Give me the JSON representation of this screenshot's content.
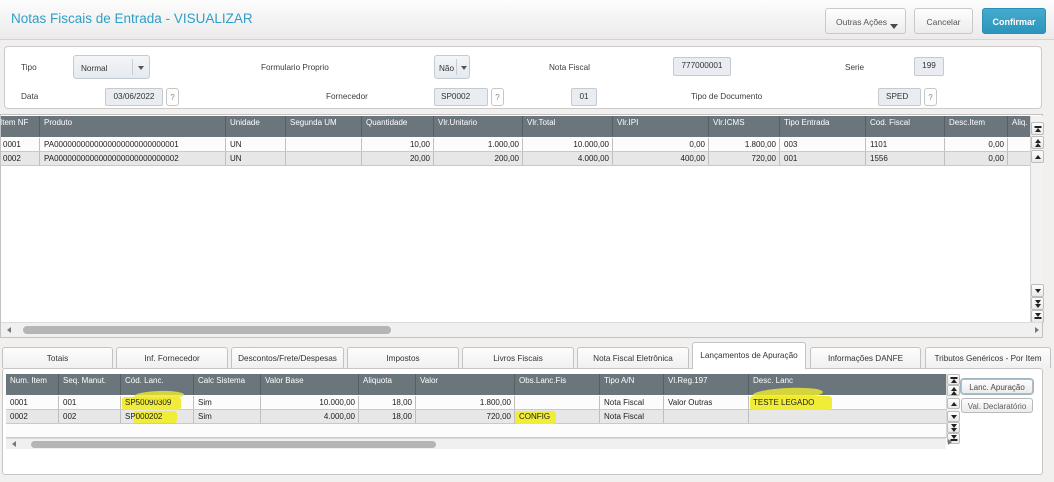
{
  "window": {
    "title": "Notas Fiscais de Entrada - VISUALIZAR"
  },
  "toolbar": {
    "outras_acoes": "Outras Ações",
    "cancelar": "Cancelar",
    "confirmar": "Confirmar"
  },
  "form": {
    "tipo": {
      "label": "Tipo",
      "value": "Normal"
    },
    "formulario_proprio": {
      "label": "Formulario Proprio",
      "value": "Não"
    },
    "nota_fiscal": {
      "label": "Nota Fiscal",
      "value": "777000001"
    },
    "serie": {
      "label": "Serie",
      "value": "199"
    },
    "data": {
      "label": "Data",
      "value": "03/06/2022",
      "helper": "?"
    },
    "fornecedor": {
      "label": "Fornecedor",
      "value": "SP0002",
      "helper": "?",
      "loja": "01"
    },
    "tipo_documento": {
      "label": "Tipo de Documento",
      "value": "SPED",
      "helper": "?"
    }
  },
  "items_grid": {
    "columns": [
      "Item NF",
      "Produto",
      "Unidade",
      "Segunda UM",
      "Quantidade",
      "Vlr.Unitario",
      "Vlr.Total",
      "Vlr.IPI",
      "Vlr.ICMS",
      "Tipo Entrada",
      "Cod. Fiscal",
      "Desc.Item",
      "Aliq. I"
    ],
    "rows": [
      [
        "0001",
        "PA0000000000000000000000000001",
        "UN",
        "",
        "10,00",
        "1.000,00",
        "10.000,00",
        "0,00",
        "1.800,00",
        "003",
        "1101",
        "0,00",
        ""
      ],
      [
        "0002",
        "PA0000000000000000000000000002",
        "UN",
        "",
        "20,00",
        "200,00",
        "4.000,00",
        "400,00",
        "720,00",
        "001",
        "1556",
        "0,00",
        ""
      ]
    ]
  },
  "tabs": [
    "Totais",
    "Inf. Fornecedor",
    "Descontos/Frete/Despesas",
    "Impostos",
    "Livros Fiscais",
    "Nota Fiscal Eletrônica",
    "Lançamentos de Apuração",
    "Informações DANFE",
    "Tributos Genéricos - Por Item"
  ],
  "active_tab": "Lançamentos de Apuração",
  "apuracao_grid": {
    "columns": [
      "Num. Item",
      "Seq. Manut.",
      "Cód. Lanc.",
      "Calc Sistema",
      "Valor Base",
      "Aliquota",
      "Valor",
      "Obs.Lanc.Fis",
      "Tipo A/N",
      "Vl.Reg.197",
      "Desc. Lanc"
    ],
    "rows": [
      [
        "0001",
        "001",
        "SP50090309",
        "Sim",
        "10.000,00",
        "18,00",
        "1.800,00",
        "",
        "Nota Fiscal",
        "Valor Outras",
        "TESTE LEGADO"
      ],
      [
        "0002",
        "002",
        "SP000202",
        "Sim",
        "4.000,00",
        "18,00",
        "720,00",
        "CONFIG",
        "Nota Fiscal",
        "",
        ""
      ]
    ],
    "highlighted_cells": [
      "SP50090309",
      "SP000202",
      "CONFIG",
      "TESTE LEGADO"
    ]
  },
  "side_buttons": {
    "lanc_apuracao": "Lanc. Apuração",
    "val_declaratorio": "Val. Declaratório"
  },
  "colors": {
    "title": "#2f9fc6",
    "confirm_button": "#2b95bb",
    "grid_header": "#6a757c",
    "highlight": "#f0ec38",
    "row_alt": "#e7e7e7"
  }
}
